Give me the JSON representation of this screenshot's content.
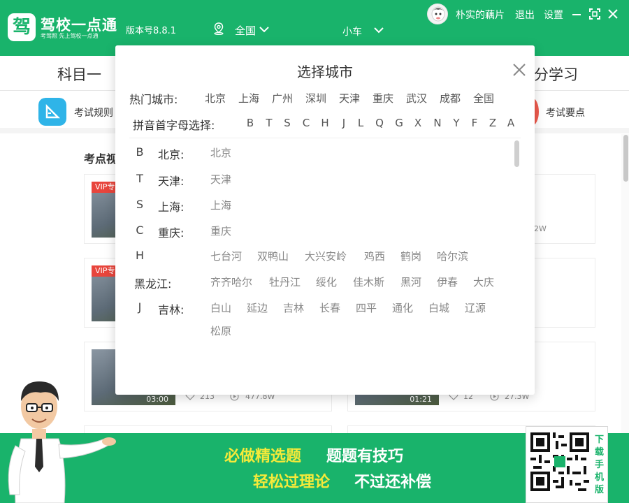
{
  "app": {
    "title": "驾校一点通",
    "logo_char": "驾",
    "slogan": "考驾照   先上驾校一点通",
    "version": "版本号8.8.1",
    "location": "全国",
    "vehicle": "小车",
    "username": "朴实的藕片",
    "logout": "退出",
    "settings": "设置",
    "brand_color": "#19b36b"
  },
  "subject_tabs": [
    "科目一",
    "分学习"
  ],
  "features": [
    {
      "label": "考试规则",
      "icon": "rules-icon",
      "color": "#2fb4e8"
    },
    {
      "label": "考试要点",
      "icon": "keypoints-icon",
      "color": "#ef5a4d"
    }
  ],
  "section_title": "考点视",
  "cards": [
    {
      "vip": "VIP专",
      "duration": "",
      "likes": "",
      "views": "2W"
    },
    {
      "vip": "VIP专",
      "duration": "",
      "likes": "",
      "views": ""
    },
    {
      "vip": "",
      "duration": "03:00",
      "likes": "213",
      "views": "477.8W"
    },
    {
      "vip": "",
      "duration": "01:21",
      "likes": "12",
      "views": "27.3W"
    }
  ],
  "banner": {
    "line1_a": "必做精选题",
    "line1_b": "题题有技巧",
    "line2_a": "轻松过理论",
    "line2_b": "不过还补偿",
    "download": [
      "下",
      "载",
      "手",
      "机",
      "版"
    ]
  },
  "modal": {
    "title": "选择城市",
    "hot_label": "热门城市:",
    "hot_cities": [
      "北京",
      "上海",
      "广州",
      "深圳",
      "天津",
      "重庆",
      "武汉",
      "成都",
      "全国"
    ],
    "pinyin_label": "拼音首字母选择:",
    "letters": [
      "B",
      "T",
      "S",
      "C",
      "H",
      "J",
      "L",
      "Q",
      "G",
      "X",
      "N",
      "Y",
      "F",
      "Z",
      "A"
    ],
    "rows": [
      {
        "letter": "B",
        "province": "北京:",
        "cities": [
          "北京"
        ]
      },
      {
        "letter": "T",
        "province": "天津:",
        "cities": [
          "天津"
        ]
      },
      {
        "letter": "S",
        "province": "上海:",
        "cities": [
          "上海"
        ]
      },
      {
        "letter": "C",
        "province": "重庆:",
        "cities": [
          "重庆"
        ]
      },
      {
        "letter": "H",
        "province": "",
        "cities": [
          "七台河",
          "双鸭山",
          "大兴安岭",
          "鸡西",
          "鹤岗",
          "哈尔滨"
        ]
      },
      {
        "letter": "",
        "province": "黑龙江:",
        "cities": [
          "齐齐哈尔",
          "牡丹江",
          "绥化",
          "佳木斯",
          "黑河",
          "伊春",
          "大庆"
        ]
      },
      {
        "letter": "J",
        "province": "吉林:",
        "cities": [
          "白山",
          "延边",
          "吉林",
          "长春",
          "四平",
          "通化",
          "白城",
          "辽源"
        ]
      },
      {
        "letter": "",
        "province": "",
        "cities": [
          "松原"
        ]
      }
    ]
  }
}
